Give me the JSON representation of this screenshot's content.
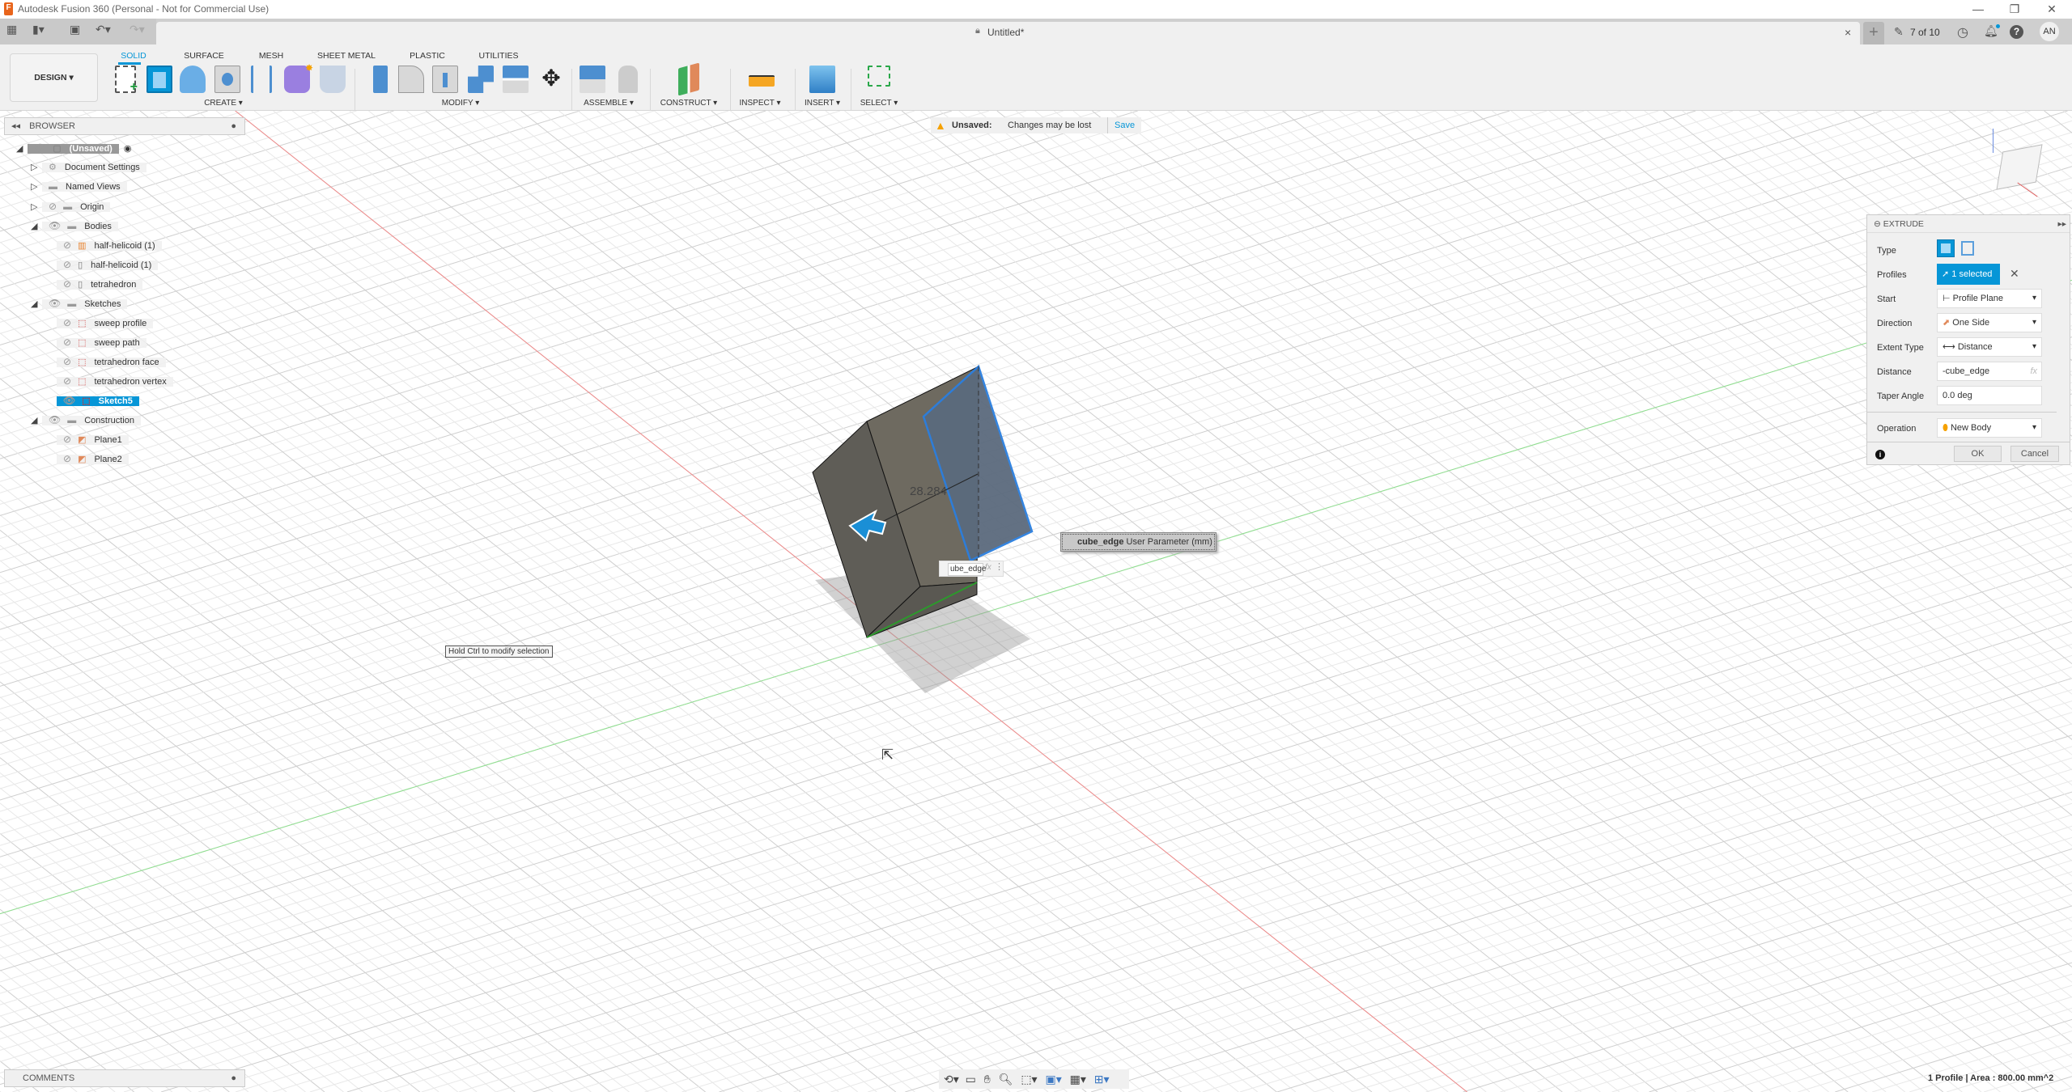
{
  "app": {
    "title": "Autodesk Fusion 360 (Personal - Not for Commercial Use)",
    "doc_title": "Untitled*",
    "version_label": "7 of 10",
    "user_initials": "AN"
  },
  "toolbar": {
    "workspace": "DESIGN ▾",
    "tabs": [
      "SOLID",
      "SURFACE",
      "MESH",
      "SHEET METAL",
      "PLASTIC",
      "UTILITIES"
    ],
    "groups": [
      "CREATE ▾",
      "MODIFY ▾",
      "ASSEMBLE ▾",
      "CONSTRUCT ▾",
      "INSPECT ▾",
      "INSERT ▾",
      "SELECT ▾"
    ]
  },
  "banner": {
    "title": "Unsaved:",
    "message": "Changes may be lost",
    "action": "Save"
  },
  "browser": {
    "title": "BROWSER",
    "items": [
      {
        "label": "(Unsaved)"
      },
      {
        "label": "Document Settings"
      },
      {
        "label": "Named Views"
      },
      {
        "label": "Origin"
      },
      {
        "label": "Bodies"
      },
      {
        "label": "half-helicoid (1)"
      },
      {
        "label": "half-helicoid (1)"
      },
      {
        "label": "tetrahedron"
      },
      {
        "label": "Sketches"
      },
      {
        "label": "sweep profile"
      },
      {
        "label": "sweep path"
      },
      {
        "label": "tetrahedron face"
      },
      {
        "label": "tetrahedron vertex"
      },
      {
        "label": "Sketch5"
      },
      {
        "label": "Construction"
      },
      {
        "label": "Plane1"
      },
      {
        "label": "Plane2"
      }
    ]
  },
  "comments": {
    "title": "COMMENTS"
  },
  "extrude": {
    "title": "EXTRUDE",
    "fields": {
      "type": "Type",
      "profiles": "Profiles",
      "start": "Start",
      "direction": "Direction",
      "extent": "Extent Type",
      "distance": "Distance",
      "taper": "Taper Angle",
      "operation": "Operation"
    },
    "values": {
      "profiles": "1 selected",
      "start": "Profile Plane",
      "direction": "One Side",
      "extent": "Distance",
      "distance": "-cube_edge",
      "taper": "0.0 deg",
      "operation": "New Body"
    },
    "fx": "fx",
    "ok": "OK",
    "cancel": "Cancel"
  },
  "canvas": {
    "dimension": "28.284",
    "input_value": "ube_edge",
    "tooltip_param": "cube_edge",
    "tooltip_desc": "User Parameter (mm)",
    "hint": "Hold Ctrl to modify selection",
    "status": "1 Profile | Area : 800.00 mm^2"
  },
  "colors": {
    "accent": "#0696d7",
    "selected_face": "#5b6a7d",
    "body": "#6e6a60"
  }
}
